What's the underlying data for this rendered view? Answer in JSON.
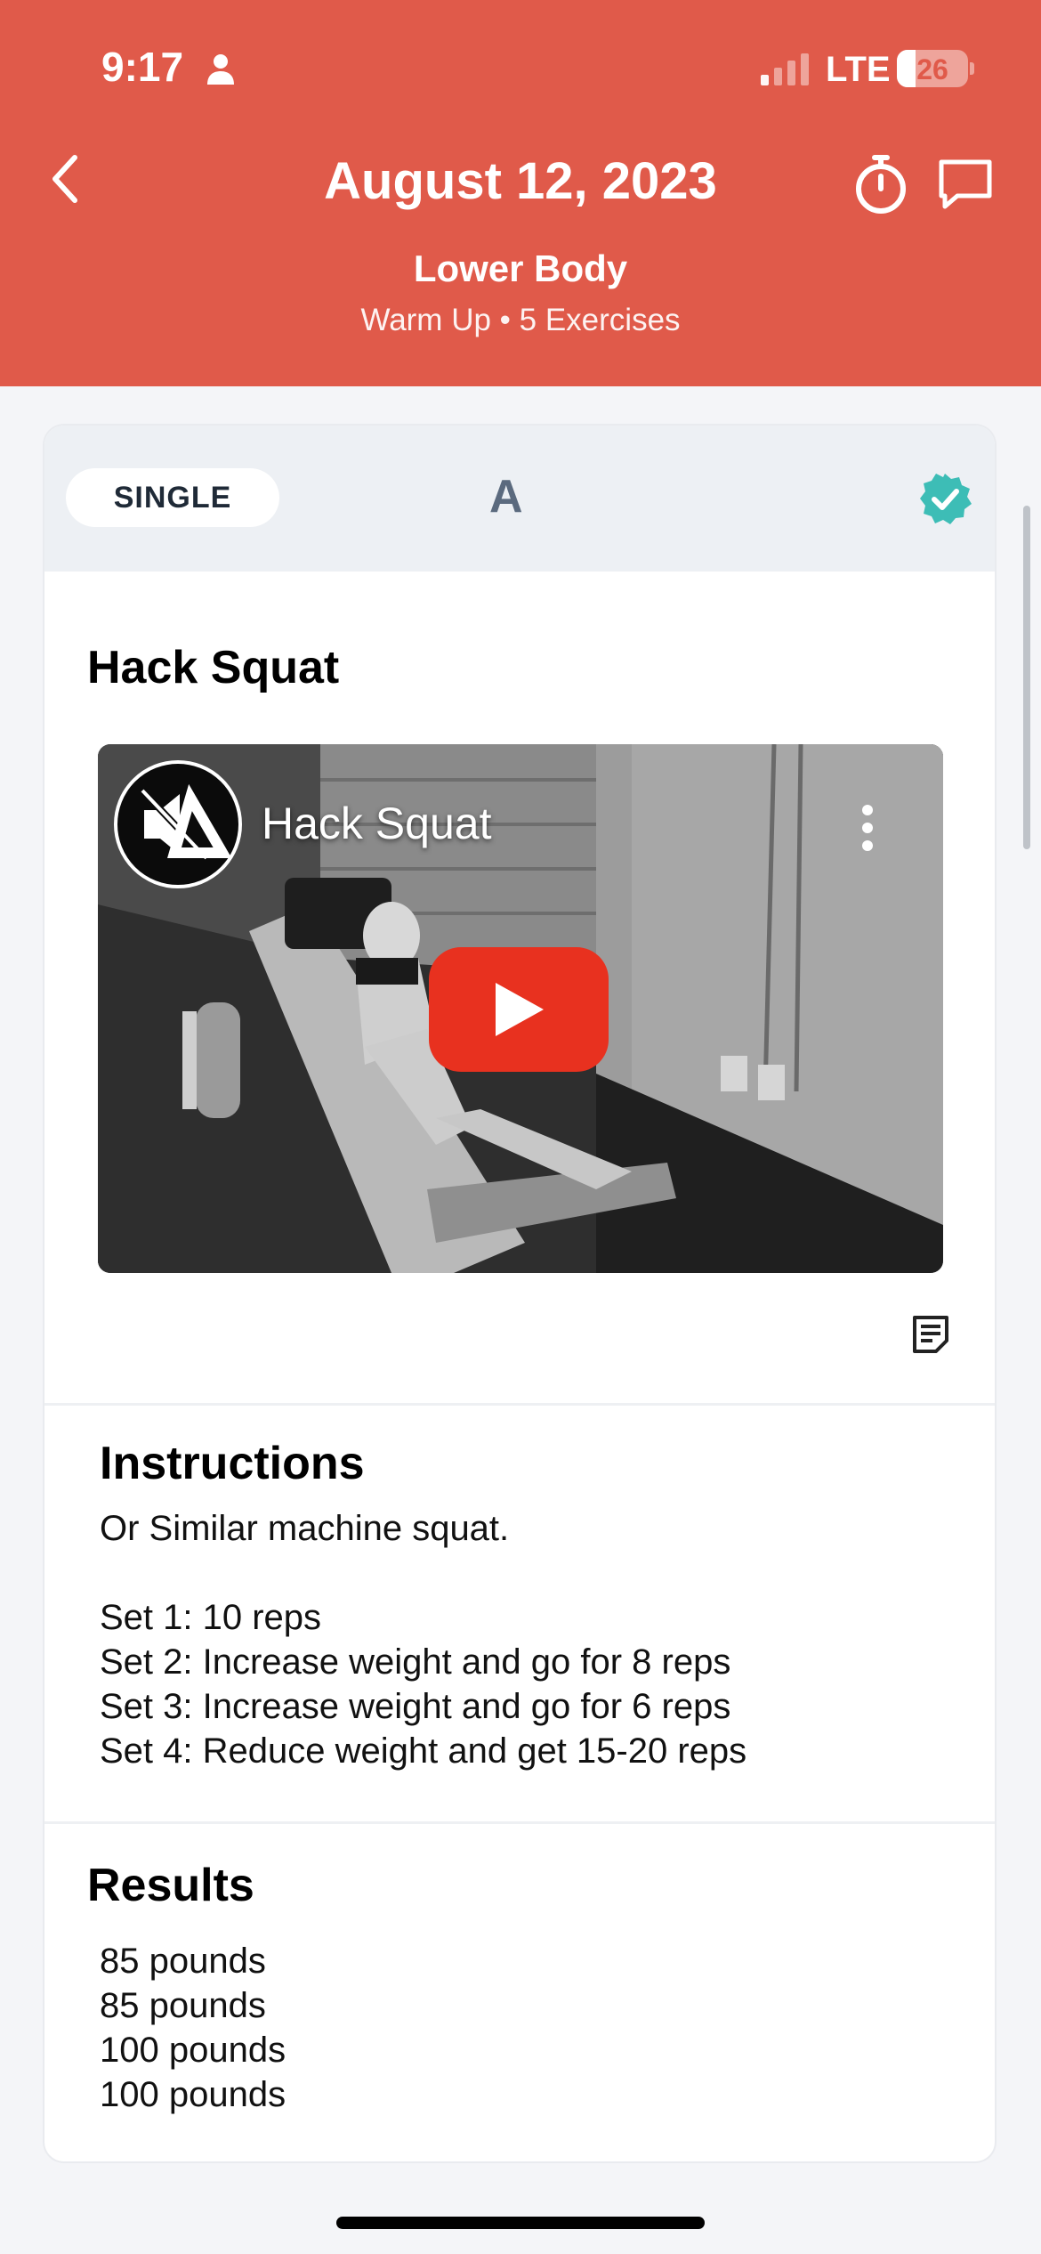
{
  "status_bar": {
    "time": "9:17",
    "network": "LTE",
    "battery": "26",
    "battery_level": 0.26
  },
  "header": {
    "title": "August 12, 2023",
    "subtitle": "Lower Body",
    "info": "Warm Up • 5 Exercises",
    "background_color": "#e05a4a"
  },
  "card": {
    "type_label": "SINGLE",
    "group_letter": "A",
    "completed": true,
    "accent_color": "#3dbdb6"
  },
  "exercise": {
    "name": "Hack Squat",
    "video": {
      "title": "Hack Squat",
      "play_color": "#e8311f"
    }
  },
  "instructions": {
    "title": "Instructions",
    "lines": [
      "Or Similar machine squat.",
      "",
      "Set 1: 10 reps",
      "Set 2: Increase weight and go for 8 reps",
      "Set 3: Increase weight and go for 6 reps",
      "Set 4: Reduce weight and get 15-20 reps"
    ]
  },
  "results": {
    "title": "Results",
    "lines": [
      "85 pounds",
      "85 pounds",
      "100 pounds",
      "100 pounds"
    ]
  },
  "icons": {
    "back": "chevron-left-icon",
    "timer": "stopwatch-icon",
    "chat": "chat-bubble-icon",
    "completed": "check-badge-icon",
    "notes": "notes-icon",
    "more": "more-vertical-icon",
    "play": "play-icon"
  }
}
